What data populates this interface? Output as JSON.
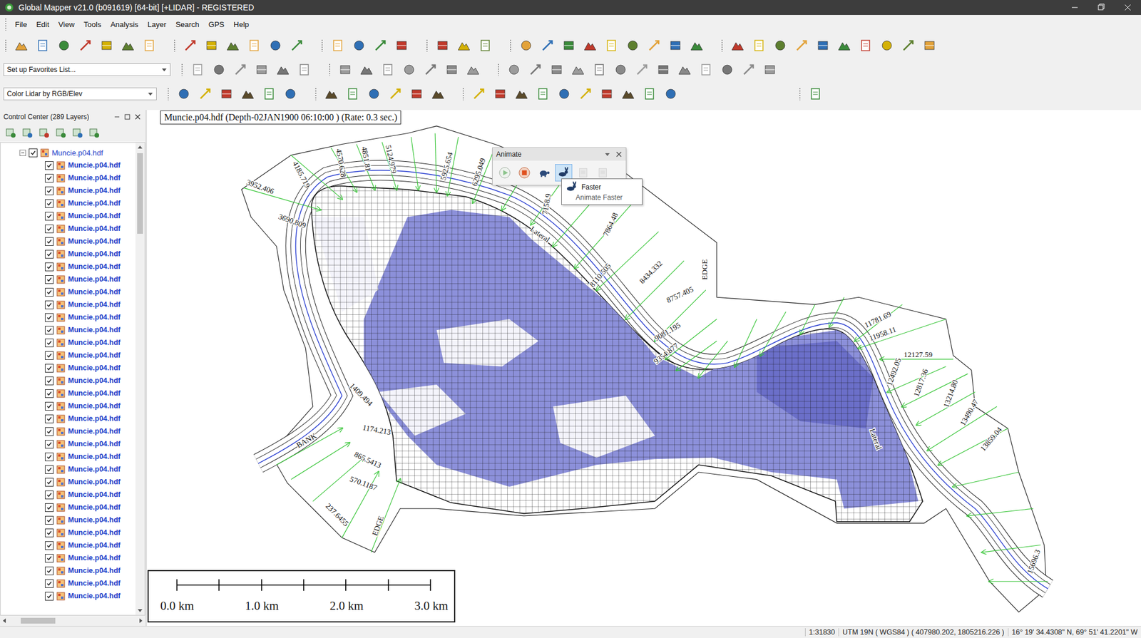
{
  "window": {
    "title": "Global Mapper v21.0 (b091619) [64-bit] [+LIDAR] - REGISTERED"
  },
  "menu": [
    "File",
    "Edit",
    "View",
    "Tools",
    "Analysis",
    "Layer",
    "Search",
    "GPS",
    "Help"
  ],
  "toolbar": {
    "favorites": {
      "value": "Set up Favorites List..."
    },
    "lidar_color": {
      "value": "Color Lidar by RGB/Elev"
    }
  },
  "control_center": {
    "title": "Control Center (289 Layers)",
    "root": {
      "label": "Muncie.p04.hdf",
      "expanded": true,
      "checked": true
    },
    "layers": [
      {
        "label": "Muncie.p04.hdf",
        "checked": true
      },
      {
        "label": "Muncie.p04.hdf",
        "checked": true
      },
      {
        "label": "Muncie.p04.hdf",
        "checked": true
      },
      {
        "label": "Muncie.p04.hdf",
        "checked": true
      },
      {
        "label": "Muncie.p04.hdf",
        "checked": true
      },
      {
        "label": "Muncie.p04.hdf",
        "checked": true
      },
      {
        "label": "Muncie.p04.hdf",
        "checked": true
      },
      {
        "label": "Muncie.p04.hdf",
        "checked": true
      },
      {
        "label": "Muncie.p04.hdf",
        "checked": true
      },
      {
        "label": "Muncie.p04.hdf",
        "checked": true
      },
      {
        "label": "Muncie.p04.hdf",
        "checked": true
      },
      {
        "label": "Muncie.p04.hdf",
        "checked": true
      },
      {
        "label": "Muncie.p04.hdf",
        "checked": true
      },
      {
        "label": "Muncie.p04.hdf",
        "checked": true
      },
      {
        "label": "Muncie.p04.hdf",
        "checked": true
      },
      {
        "label": "Muncie.p04.hdf",
        "checked": true
      },
      {
        "label": "Muncie.p04.hdf",
        "checked": true
      },
      {
        "label": "Muncie.p04.hdf",
        "checked": true
      },
      {
        "label": "Muncie.p04.hdf",
        "checked": true
      },
      {
        "label": "Muncie.p04.hdf",
        "checked": true
      },
      {
        "label": "Muncie.p04.hdf",
        "checked": true
      },
      {
        "label": "Muncie.p04.hdf",
        "checked": true
      },
      {
        "label": "Muncie.p04.hdf",
        "checked": true
      },
      {
        "label": "Muncie.p04.hdf",
        "checked": true
      },
      {
        "label": "Muncie.p04.hdf",
        "checked": true
      },
      {
        "label": "Muncie.p04.hdf",
        "checked": true
      },
      {
        "label": "Muncie.p04.hdf",
        "checked": true
      },
      {
        "label": "Muncie.p04.hdf",
        "checked": true
      },
      {
        "label": "Muncie.p04.hdf",
        "checked": true
      },
      {
        "label": "Muncie.p04.hdf",
        "checked": true
      },
      {
        "label": "Muncie.p04.hdf",
        "checked": true
      },
      {
        "label": "Muncie.p04.hdf",
        "checked": true
      },
      {
        "label": "Muncie.p04.hdf",
        "checked": true
      },
      {
        "label": "Muncie.p04.hdf",
        "checked": true
      },
      {
        "label": "Muncie.p04.hdf",
        "checked": true
      }
    ]
  },
  "map": {
    "caption": "Muncie.p04.hdf (Depth-02JAN1900 06:10:00 ) (Rate: 0.3 sec.)",
    "cross_sections": [
      {
        "label": "3952.406"
      },
      {
        "label": "4185.719"
      },
      {
        "label": "4570.628"
      },
      {
        "label": "4851.81"
      },
      {
        "label": "5124.979"
      },
      {
        "label": "5925.654"
      },
      {
        "label": "6295.049"
      },
      {
        "label": "7158.9"
      },
      {
        "label": "7864.48"
      },
      {
        "label": "8110.505"
      },
      {
        "label": "8434.332"
      },
      {
        "label": "8757.405"
      },
      {
        "label": "9081.195"
      },
      {
        "label": "9354.877"
      },
      {
        "label": "11781.69"
      },
      {
        "label": "11958.11"
      },
      {
        "label": "12127.59"
      },
      {
        "label": "12492.05"
      },
      {
        "label": "12817.36"
      },
      {
        "label": "13214.80"
      },
      {
        "label": "13490.47"
      },
      {
        "label": "13859.04"
      },
      {
        "label": "15696.3"
      },
      {
        "label": "1174.213"
      },
      {
        "label": "865.5413"
      },
      {
        "label": "570.1187"
      },
      {
        "label": "237.6455"
      },
      {
        "label": "1409.494"
      },
      {
        "label": "3690.809"
      }
    ],
    "annotations": [
      {
        "label": "EDGE"
      },
      {
        "label": "EDGE"
      },
      {
        "label": "BANK"
      },
      {
        "label": "Lateral"
      },
      {
        "label": "Lateral"
      }
    ]
  },
  "scale_bar": {
    "ticks": [
      "0.0 km",
      "1.0 km",
      "2.0 km",
      "3.0 km"
    ]
  },
  "animate": {
    "title": "Animate",
    "buttons": [
      {
        "kind": "play",
        "disabled": false,
        "hovered": false
      },
      {
        "kind": "stop",
        "disabled": false,
        "hovered": false
      },
      {
        "kind": "slower",
        "disabled": false,
        "hovered": false
      },
      {
        "kind": "faster",
        "disabled": false,
        "hovered": true
      },
      {
        "kind": "record",
        "disabled": true,
        "hovered": false
      },
      {
        "kind": "export",
        "disabled": true,
        "hovered": false
      }
    ],
    "tooltip": {
      "title": "Faster",
      "description": "Animate Faster"
    }
  },
  "status_bar": {
    "scale": "1:31830",
    "projection": "UTM 19N ( WGS84 ) ( 407980.202, 1805216.226 )",
    "coordinates": "16° 19' 34.4308\" N, 69° 51' 41.2201\" W"
  }
}
